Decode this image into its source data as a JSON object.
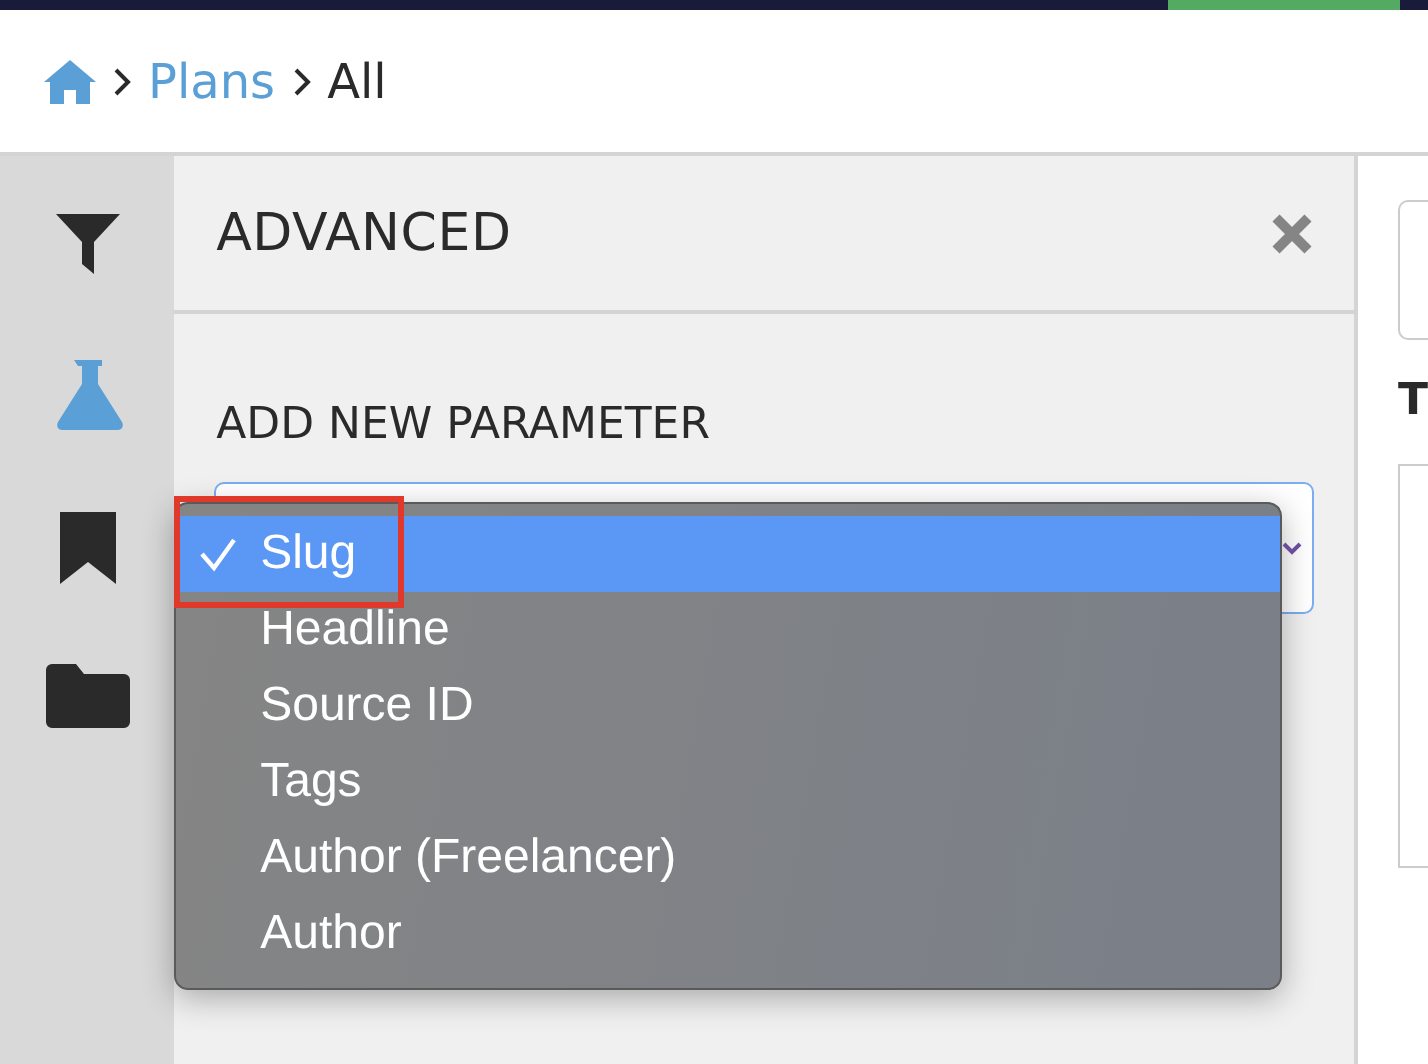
{
  "breadcrumb": [
    {
      "label": "Plans",
      "kind": "link"
    },
    {
      "label": "All",
      "kind": "current"
    }
  ],
  "sidebar": {
    "items": [
      {
        "kind": "filter",
        "selected": false
      },
      {
        "kind": "flask",
        "selected": true
      },
      {
        "kind": "bookmark",
        "selected": false
      },
      {
        "kind": "folder",
        "selected": false
      }
    ]
  },
  "panel": {
    "title": "ADVANCED",
    "section_label": "ADD NEW PARAMETER"
  },
  "dropdown": {
    "options": [
      {
        "label": "Slug",
        "selected": true
      },
      {
        "label": "Headline",
        "selected": false
      },
      {
        "label": "Source ID",
        "selected": false
      },
      {
        "label": "Tags",
        "selected": false
      },
      {
        "label": "Author (Freelancer)",
        "selected": false
      },
      {
        "label": "Author",
        "selected": false
      }
    ],
    "highlighted": true
  },
  "right_pane": {
    "heading": "T"
  }
}
